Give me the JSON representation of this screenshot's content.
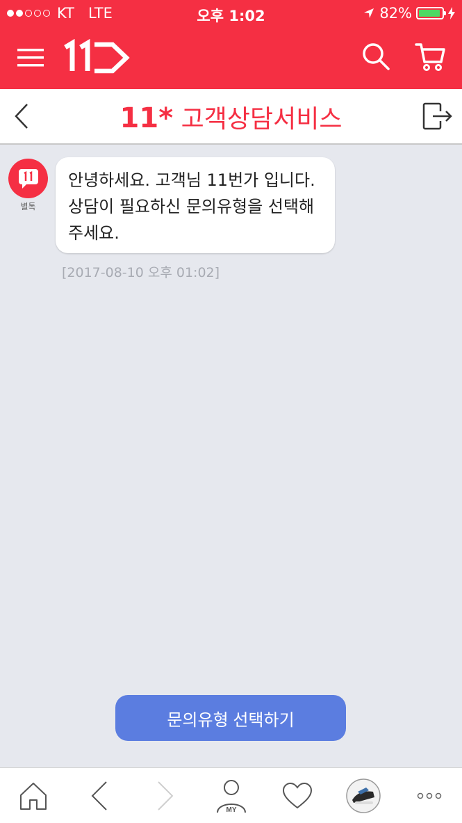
{
  "status_bar": {
    "carrier": "KT",
    "network": "LTE",
    "time": "오후 1:02",
    "battery": "82%"
  },
  "header": {
    "logo": "11",
    "menu_icon": "hamburger-icon",
    "search_icon": "search-icon",
    "cart_icon": "cart-icon"
  },
  "subheader": {
    "brand": "11*",
    "title": "고객상담서비스",
    "back_icon": "chevron-left-icon",
    "exit_icon": "exit-icon"
  },
  "chat": {
    "bot_name": "별톡",
    "message": "안녕하세요. 고객님 11번가 입니다. 상담이 필요하신 문의유형을 선택해 주세요.",
    "timestamp": "[2017-08-10 오후 01:02]"
  },
  "cta": {
    "label": "문의유형 선택하기"
  },
  "tabbar": {
    "my_label": "MY",
    "more_label": "ooo"
  },
  "colors": {
    "brand_red": "#f52f43",
    "cta_blue": "#5b7de0",
    "chat_bg": "#e6e8ee"
  }
}
